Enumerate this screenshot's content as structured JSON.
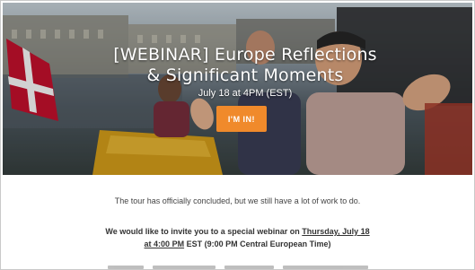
{
  "hero": {
    "title_line1": "[WEBINAR] Europe Reflections",
    "title_line2": "& Significant Moments",
    "date": "July 18 at 4PM (EST)",
    "cta_label": "I'M IN!"
  },
  "content": {
    "intro": "The tour has officially concluded, but we still have a lot of work to do.",
    "invite_prefix": "We would like to invite you to a special webinar on ",
    "invite_date_link": "Thursday, July 18",
    "invite_time_link": "at 4:00 PM",
    "invite_suffix": " EST (9:00 PM Central European Time)"
  },
  "colors": {
    "accent": "#f08a2b",
    "flag_red": "#c8102e",
    "text": "#444444"
  }
}
